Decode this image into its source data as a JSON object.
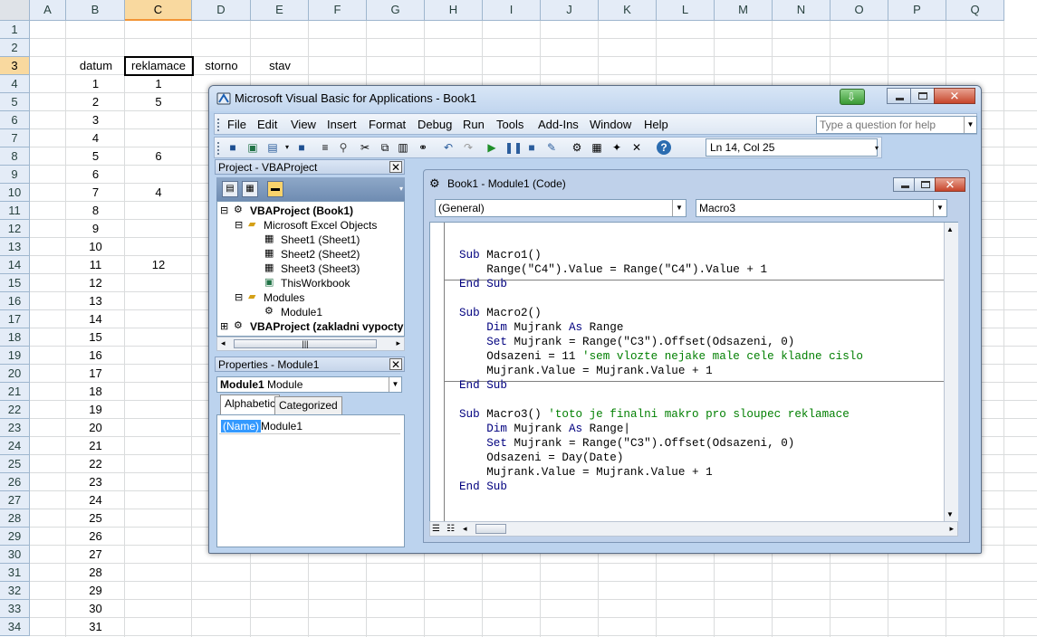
{
  "excel": {
    "columns": [
      "A",
      "B",
      "C",
      "D",
      "E",
      "F",
      "G",
      "H",
      "I",
      "J",
      "K",
      "L",
      "M",
      "N",
      "O",
      "P",
      "Q"
    ],
    "selected_column": "C",
    "selected_row": "3",
    "rows": [
      "1",
      "2",
      "3",
      "4",
      "5",
      "6",
      "7",
      "8",
      "9",
      "10",
      "11",
      "12",
      "13",
      "14",
      "15",
      "16",
      "17",
      "18",
      "19",
      "20",
      "21",
      "22",
      "23",
      "24",
      "25",
      "26",
      "27",
      "28",
      "29",
      "30",
      "31",
      "32",
      "33",
      "34"
    ],
    "headers": {
      "datum": "datum",
      "reklamace": "reklamace",
      "storno": "storno",
      "stav": "stav"
    },
    "datum_values": [
      "1",
      "2",
      "3",
      "4",
      "5",
      "6",
      "7",
      "8",
      "9",
      "10",
      "11",
      "12",
      "13",
      "14",
      "15",
      "16",
      "17",
      "18",
      "19",
      "20",
      "21",
      "22",
      "23",
      "24",
      "25",
      "26",
      "27",
      "28",
      "29",
      "30",
      "31"
    ],
    "reklamace_values": [
      {
        "row": 4,
        "value": "1"
      },
      {
        "row": 5,
        "value": "5"
      },
      {
        "row": 8,
        "value": "6"
      },
      {
        "row": 10,
        "value": "4"
      },
      {
        "row": 14,
        "value": "12"
      }
    ]
  },
  "vbe": {
    "title": "Microsoft Visual Basic for Applications - Book1",
    "menu": [
      "File",
      "Edit",
      "View",
      "Insert",
      "Format",
      "Debug",
      "Run",
      "Tools",
      "Add-Ins",
      "Window",
      "Help"
    ],
    "help_placeholder": "Type a question for help",
    "position": "Ln 14, Col 25",
    "project_panel_title": "Project - VBAProject",
    "tree": {
      "root": "VBAProject (Book1)",
      "excel_objects": "Microsoft Excel Objects",
      "sheet1": "Sheet1 (Sheet1)",
      "sheet2": "Sheet2 (Sheet2)",
      "sheet3": "Sheet3 (Sheet3)",
      "thisworkbook": "ThisWorkbook",
      "modules": "Modules",
      "module1": "Module1",
      "root2": "VBAProject (zakladni vypocty"
    },
    "properties_title": "Properties - Module1",
    "properties_object_name": "Module1",
    "properties_object_type": "Module",
    "tab_alphabetic": "Alphabetic",
    "tab_categorized": "Categorized",
    "prop_name_label": "(Name)",
    "prop_name_value": "Module1",
    "code_window_title": "Book1 - Module1 (Code)",
    "object_combo": "(General)",
    "procedure_combo": "Macro3"
  }
}
